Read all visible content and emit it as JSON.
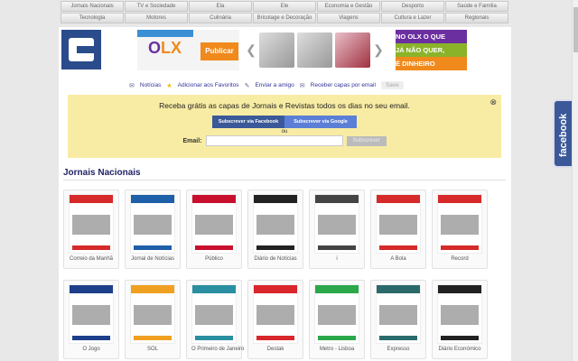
{
  "nav": [
    "Jornais Nacionais",
    "TV e Sociedade",
    "Ela",
    "Ele",
    "Economia e Gestão",
    "Desporto",
    "Saúde e Família",
    "Tecnologia",
    "Motores",
    "Culinária",
    "Bricolage e Decoração",
    "Viagens",
    "Cultura e Lazer",
    "Regionais"
  ],
  "ad": {
    "brand": "OLX",
    "button": "Publicar",
    "banner": [
      "NO OLX O QUE",
      "JÁ NÃO QUER,",
      "É DINHEIRO"
    ]
  },
  "links": {
    "news": "Notícias",
    "fav": "Adicionar aos Favoritos",
    "send": "Enviar a amigo",
    "email": "Receber capas por email",
    "save": "Save"
  },
  "subscribe": {
    "title": "Receba grátis as capas de Jornais e Revistas todos os dias no seu email.",
    "facebook": "Subscrever via Facebook",
    "google": "Subscrever via Google",
    "or": "ou",
    "email_label": "Email:",
    "email_value": "",
    "submit": "Subscrever"
  },
  "section": "Jornais Nacionais",
  "papers": [
    {
      "name": "Correio da Manhã",
      "color": "#d62a2a"
    },
    {
      "name": "Jornal de Notícias",
      "color": "#1d5fa8"
    },
    {
      "name": "Público",
      "color": "#c8102e"
    },
    {
      "name": "Diário de Notícias",
      "color": "#222222"
    },
    {
      "name": "i",
      "color": "#444444"
    },
    {
      "name": "A Bola",
      "color": "#d62a2a"
    },
    {
      "name": "Record",
      "color": "#d62a2a"
    },
    {
      "name": "O Jogo",
      "color": "#1d3f8a"
    },
    {
      "name": "SOL",
      "color": "#f0a020"
    },
    {
      "name": "O Primeiro de Janeiro",
      "color": "#2a8fa0"
    },
    {
      "name": "Destak",
      "color": "#d8262a"
    },
    {
      "name": "Metro - Lisboa",
      "color": "#2aa84a"
    },
    {
      "name": "Expresso",
      "color": "#2a6a6a"
    },
    {
      "name": "Diário Económico",
      "color": "#222222"
    }
  ],
  "facebook_tab": "facebook"
}
